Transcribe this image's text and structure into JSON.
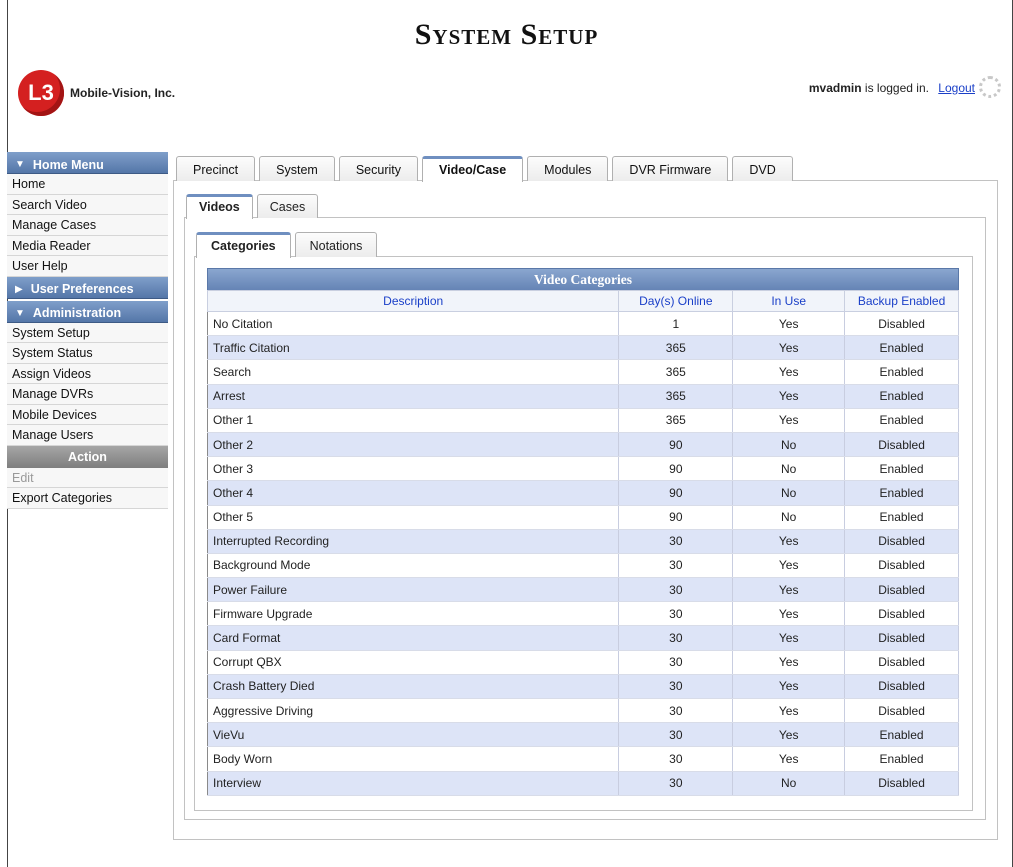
{
  "header": {
    "title": "System Setup",
    "company": "Mobile-Vision, Inc.",
    "logo_text": "L3",
    "user": "mvadmin",
    "logged_in_text": "is logged in.",
    "logout_label": "Logout"
  },
  "sidebar": {
    "home_menu": {
      "label": "Home Menu",
      "items": [
        "Home",
        "Search Video",
        "Manage Cases",
        "Media Reader",
        "User Help"
      ]
    },
    "user_prefs": {
      "label": "User Preferences"
    },
    "administration": {
      "label": "Administration",
      "items": [
        "System Setup",
        "System Status",
        "Assign Videos",
        "Manage DVRs",
        "Mobile Devices",
        "Manage Users"
      ]
    },
    "action": {
      "label": "Action",
      "items": [
        "Edit",
        "Export Categories"
      ]
    }
  },
  "main_tabs": [
    "Precinct",
    "System",
    "Security",
    "Video/Case",
    "Modules",
    "DVR Firmware",
    "DVD"
  ],
  "sub_tabs": [
    "Videos",
    "Cases"
  ],
  "inner_tabs": [
    "Categories",
    "Notations"
  ],
  "table": {
    "caption": "Video Categories",
    "columns": [
      "Description",
      "Day(s) Online",
      "In Use",
      "Backup Enabled"
    ],
    "rows": [
      [
        "No Citation",
        "1",
        "Yes",
        "Disabled"
      ],
      [
        "Traffic Citation",
        "365",
        "Yes",
        "Enabled"
      ],
      [
        "Search",
        "365",
        "Yes",
        "Enabled"
      ],
      [
        "Arrest",
        "365",
        "Yes",
        "Enabled"
      ],
      [
        "Other 1",
        "365",
        "Yes",
        "Enabled"
      ],
      [
        "Other 2",
        "90",
        "No",
        "Disabled"
      ],
      [
        "Other 3",
        "90",
        "No",
        "Enabled"
      ],
      [
        "Other 4",
        "90",
        "No",
        "Enabled"
      ],
      [
        "Other 5",
        "90",
        "No",
        "Enabled"
      ],
      [
        "Interrupted Recording",
        "30",
        "Yes",
        "Disabled"
      ],
      [
        "Background Mode",
        "30",
        "Yes",
        "Disabled"
      ],
      [
        "Power Failure",
        "30",
        "Yes",
        "Disabled"
      ],
      [
        "Firmware Upgrade",
        "30",
        "Yes",
        "Disabled"
      ],
      [
        "Card Format",
        "30",
        "Yes",
        "Disabled"
      ],
      [
        "Corrupt QBX",
        "30",
        "Yes",
        "Disabled"
      ],
      [
        "Crash Battery Died",
        "30",
        "Yes",
        "Disabled"
      ],
      [
        "Aggressive Driving",
        "30",
        "Yes",
        "Disabled"
      ],
      [
        "VieVu",
        "30",
        "Yes",
        "Enabled"
      ],
      [
        "Body Worn",
        "30",
        "Yes",
        "Enabled"
      ],
      [
        "Interview",
        "30",
        "No",
        "Disabled"
      ]
    ]
  },
  "colors": {
    "menu_header": "#5476a8",
    "row_alt": "#dde4f7",
    "link": "#1a3fc8",
    "logo_red": "#d42020"
  }
}
